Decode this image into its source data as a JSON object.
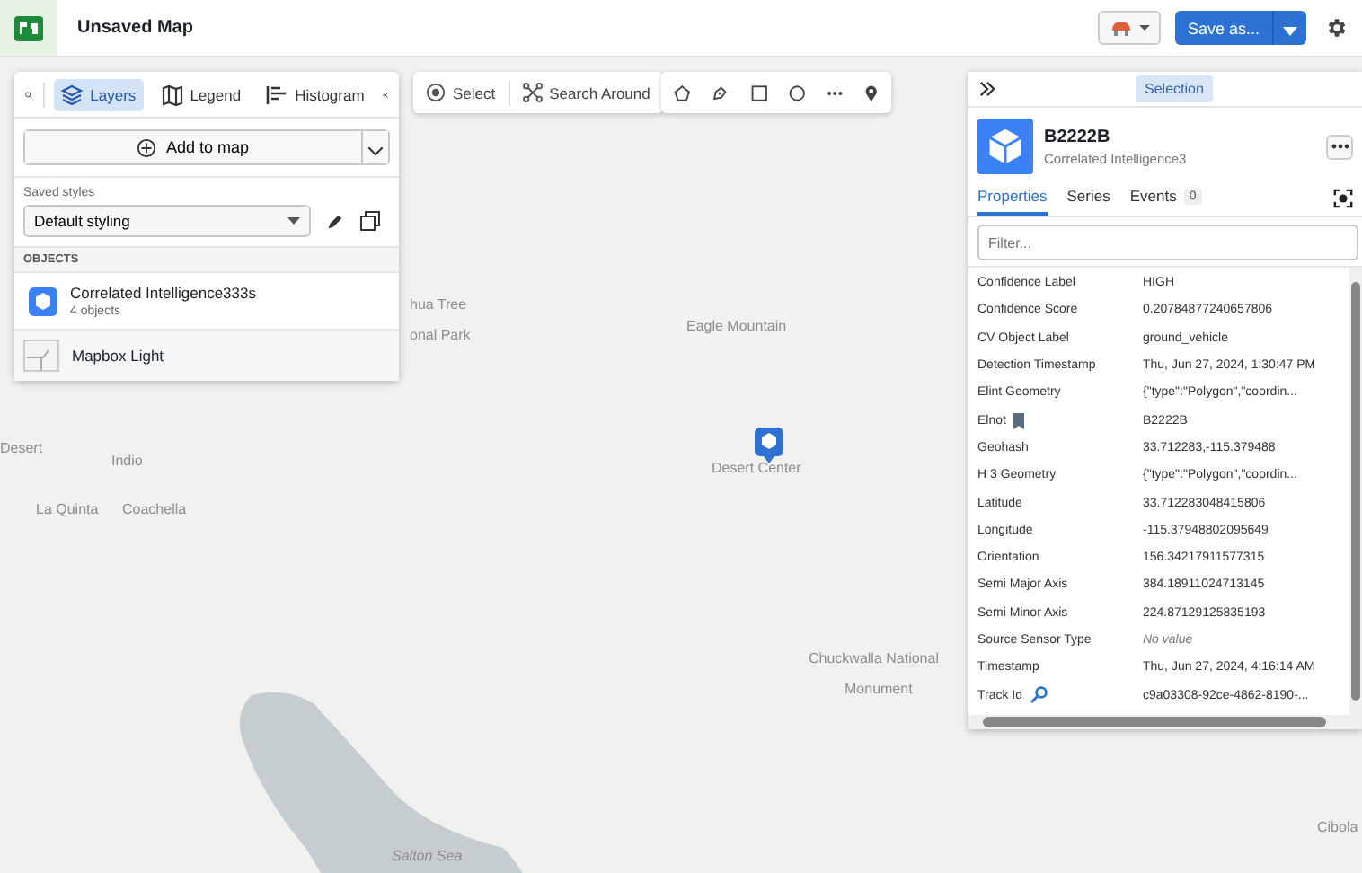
{
  "header": {
    "title": "Unsaved Map",
    "save_button": "Save as..."
  },
  "left_panel": {
    "tabs": [
      {
        "label": "Layers",
        "selected": true
      },
      {
        "label": "Legend",
        "selected": false
      },
      {
        "label": "Histogram",
        "selected": false
      }
    ],
    "add_button": "Add to map",
    "saved_styles_label": "Saved styles",
    "style_select": "Default styling",
    "section_label": "OBJECTS",
    "layers": [
      {
        "kind": "object",
        "name": "Correlated Intelligence333s",
        "count": "4 objects"
      },
      {
        "kind": "basemap",
        "name": "Mapbox Light"
      }
    ]
  },
  "map_tools": [
    "Select",
    "Search Around"
  ],
  "map_labels": [
    "hua Tree",
    "onal Park",
    "Eagle Mountain",
    "Desert",
    "Indio",
    "La Quinta",
    "Coachella",
    "Desert Center",
    "Chuckwalla National",
    "Monument",
    "Salton Sea",
    "Cibola"
  ],
  "selection": {
    "tab": "Selection",
    "title": "B2222B",
    "subtitle": "Correlated Intelligence3",
    "tabs": [
      {
        "label": "Properties",
        "selected": true
      },
      {
        "label": "Series",
        "selected": false
      },
      {
        "label": "Events",
        "selected": false,
        "count": "0"
      }
    ],
    "filter_placeholder": "Filter...",
    "properties": [
      {
        "kind": "plain",
        "name": "Confidence Label",
        "value": "HIGH"
      },
      {
        "kind": "plain",
        "name": "Confidence Score",
        "value": "0.20784877240657806"
      },
      {
        "kind": "plain",
        "name": "CV Object Label",
        "value": "ground_vehicle"
      },
      {
        "kind": "plain",
        "name": "Detection Timestamp",
        "value": "Thu, Jun 27, 2024, 1:30:47 PM"
      },
      {
        "kind": "plain",
        "name": "Elint Geometry",
        "value": "{\"type\":\"Polygon\",\"coordin..."
      },
      {
        "kind": "bookmark",
        "name": "Elnot",
        "value": "B2222B"
      },
      {
        "kind": "plain",
        "name": "Geohash",
        "value": "33.712283,-115.379488"
      },
      {
        "kind": "plain",
        "name": "H 3 Geometry",
        "value": "{\"type\":\"Polygon\",\"coordin..."
      },
      {
        "kind": "plain",
        "name": "Latitude",
        "value": "33.712283048415806"
      },
      {
        "kind": "plain",
        "name": "Longitude",
        "value": "-115.37948802095649"
      },
      {
        "kind": "plain",
        "name": "Orientation",
        "value": "156.34217911577315"
      },
      {
        "kind": "plain",
        "name": "Semi Major Axis",
        "value": "384.18911024713145"
      },
      {
        "kind": "plain",
        "name": "Semi Minor Axis",
        "value": "224.87129125835193"
      },
      {
        "kind": "plain",
        "name": "Source Sensor Type",
        "value": "No value",
        "empty": true
      },
      {
        "kind": "plain",
        "name": "Timestamp",
        "value": "Thu, Jun 27, 2024, 4:16:14 AM"
      },
      {
        "kind": "key",
        "name": "Track Id",
        "value": "c9a03308-92ce-4862-8190-..."
      }
    ]
  }
}
